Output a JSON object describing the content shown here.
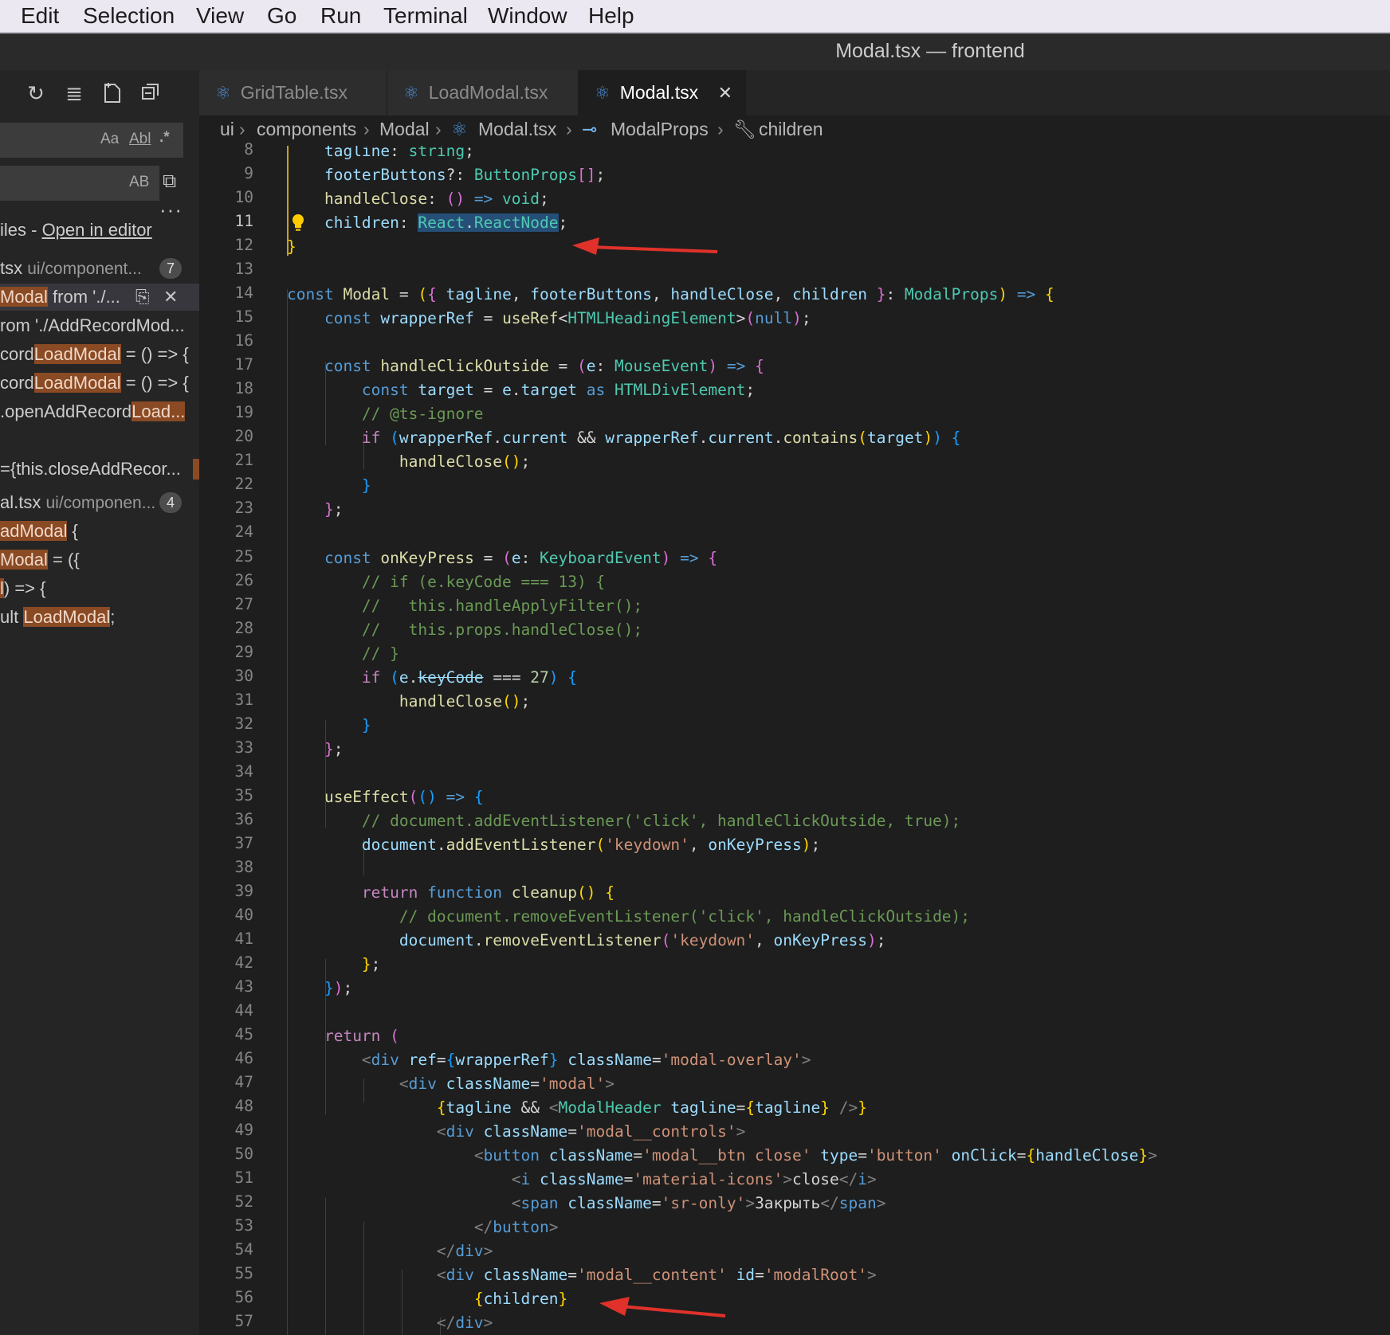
{
  "menu": [
    "Edit",
    "Selection",
    "View",
    "Go",
    "Run",
    "Terminal",
    "Window",
    "Help"
  ],
  "window": {
    "title": "Modal.tsx — frontend"
  },
  "sidebar": {
    "search_options": [
      "Aa",
      "Abl",
      ".*"
    ],
    "replace_option": "AB",
    "more": "···",
    "files_prefix": "iles - ",
    "open_in_editor": "Open in editor",
    "file1": {
      "name": "tsx",
      "path": "ui/component...",
      "count": "7"
    },
    "match1_a": "Modal",
    "match1_b": " from './...",
    "match2": "rom './AddRecordMod...",
    "match3_a": "cord",
    "match3_b": "LoadModal",
    "match3_c": " = () => {",
    "match4_a": "cord",
    "match4_b": "LoadModal",
    "match4_c": " = () => {",
    "match5_a": ".openAddRecord",
    "match5_b": "Load...",
    "match6": "={this.closeAddRecor...",
    "file2": {
      "name": "al.tsx",
      "path": "ui/componen...",
      "count": "4"
    },
    "match7_a": "adModal",
    "match7_b": " {",
    "match8_a": "Modal",
    "match8_b": " = ({",
    "match9_a": "l",
    "match9_b": ") => {",
    "match10_a": "ult ",
    "match10_b": "LoadModal",
    "match10_c": ";"
  },
  "tabs": [
    {
      "label": "GridTable.tsx"
    },
    {
      "label": "LoadModal.tsx"
    },
    {
      "label": "Modal.tsx",
      "close": "✕"
    }
  ],
  "breadcrumb": [
    "ui",
    "components",
    "Modal",
    "Modal.tsx",
    "ModalProps",
    "children"
  ],
  "editor": {
    "line_numbers": [
      "8",
      "9",
      "10",
      "11",
      "12",
      "13",
      "14",
      "15",
      "16",
      "17",
      "18",
      "19",
      "20",
      "21",
      "22",
      "23",
      "24",
      "25",
      "26",
      "27",
      "28",
      "29",
      "30",
      "31",
      "32",
      "33",
      "34",
      "35",
      "36",
      "37",
      "38",
      "39",
      "40",
      "41",
      "42",
      "43",
      "44",
      "45",
      "46",
      "47",
      "48",
      "49",
      "50",
      "51",
      "52",
      "53",
      "54",
      "55",
      "56",
      "57"
    ],
    "current_line": "11"
  },
  "colors": {
    "background": "#1e1e1e",
    "keyword": "#569cd6",
    "control": "#c586c0",
    "type": "#4ec9b0",
    "variable": "#9cdcfe",
    "function": "#dcdcaa",
    "string": "#ce9178",
    "comment": "#6a9955",
    "number": "#b5cea8",
    "arrow": "#e0322a"
  }
}
